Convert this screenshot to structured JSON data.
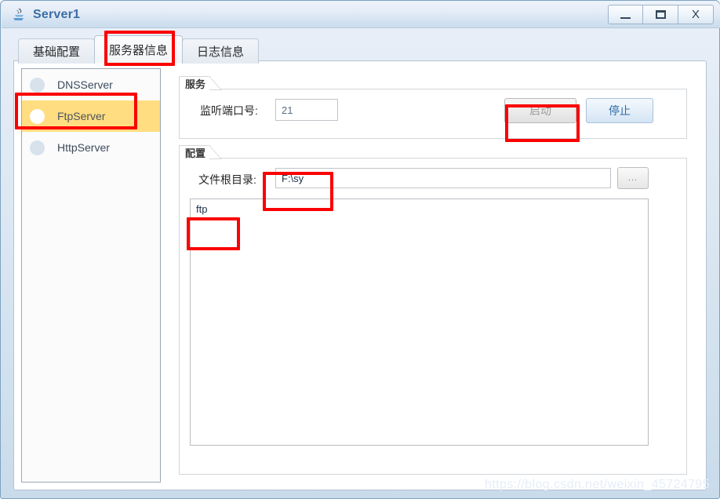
{
  "window": {
    "title": "Server1",
    "icon": "java-app-icon",
    "controls": {
      "minimize_label": "",
      "maximize_label": "",
      "close_label": "X"
    }
  },
  "tabs": [
    {
      "label": "基础配置",
      "selected": false
    },
    {
      "label": "服务器信息",
      "selected": true
    },
    {
      "label": "日志信息",
      "selected": false
    }
  ],
  "sidebar": {
    "items": [
      {
        "label": "DNSServer",
        "selected": false,
        "icon": "status-dot-icon"
      },
      {
        "label": "FtpServer",
        "selected": true,
        "icon": "status-dot-icon"
      },
      {
        "label": "HttpServer",
        "selected": false,
        "icon": "status-dot-icon"
      }
    ]
  },
  "service_group": {
    "title": "服务",
    "port_label": "监听端口号:",
    "port_value": "21",
    "start_button": "启动",
    "stop_button": "停止"
  },
  "config_group": {
    "title": "配置",
    "root_dir_label": "文件根目录:",
    "root_dir_value": "F:\\sy",
    "browse_button": "...",
    "log_text": "ftp"
  },
  "watermark": "https://blog.csdn.net/weixin_45724795",
  "colors": {
    "selected_row": "#ffdd80",
    "annotation": "#fb0000",
    "title_text": "#3b6ea5",
    "primary_button_text": "#2f6ba8"
  }
}
